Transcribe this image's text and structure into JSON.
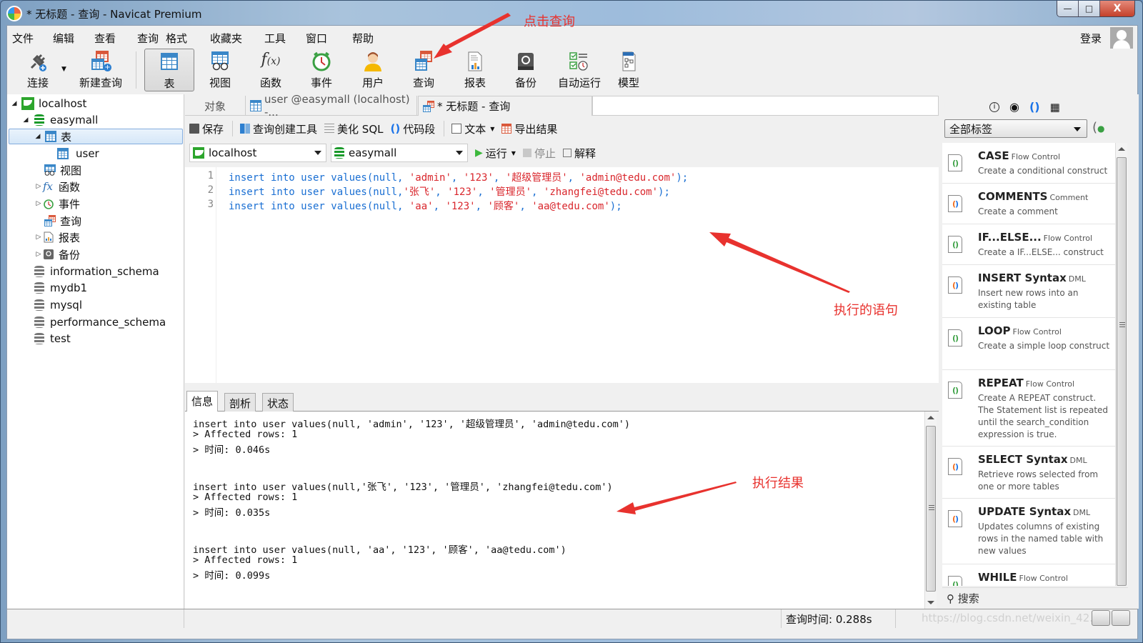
{
  "window": {
    "title": "* 无标题 - 查询 - Navicat Premium",
    "controls": {
      "minimize": "—",
      "maximize": "□",
      "close": "X"
    }
  },
  "menubar": {
    "items": [
      "文件",
      "编辑",
      "查看",
      "查询",
      "格式",
      "收藏夹",
      "工具",
      "窗口",
      "帮助"
    ],
    "login": "登录"
  },
  "toolbar": {
    "items": [
      {
        "label": "连接",
        "icon": "plug-icon"
      },
      {
        "label": "新建查询",
        "icon": "new-query-icon"
      },
      {
        "label": "表",
        "icon": "table-icon",
        "active": true
      },
      {
        "label": "视图",
        "icon": "view-icon"
      },
      {
        "label": "函数",
        "icon": "function-icon"
      },
      {
        "label": "事件",
        "icon": "clock-icon"
      },
      {
        "label": "用户",
        "icon": "user-icon"
      },
      {
        "label": "查询",
        "icon": "query-icon"
      },
      {
        "label": "报表",
        "icon": "report-icon"
      },
      {
        "label": "备份",
        "icon": "backup-icon"
      },
      {
        "label": "自动运行",
        "icon": "schedule-icon"
      },
      {
        "label": "模型",
        "icon": "model-icon"
      }
    ]
  },
  "sidebar": {
    "tree": [
      {
        "label": "localhost",
        "level": 0,
        "expanded": true,
        "type": "server"
      },
      {
        "label": "easymall",
        "level": 1,
        "expanded": true,
        "type": "db-open"
      },
      {
        "label": "表",
        "level": 2,
        "expanded": true,
        "type": "tables",
        "selected": true
      },
      {
        "label": "user",
        "level": 3,
        "type": "table"
      },
      {
        "label": "视图",
        "level": 2,
        "type": "views"
      },
      {
        "label": "函数",
        "level": 2,
        "type": "functions",
        "collapsed": true
      },
      {
        "label": "事件",
        "level": 2,
        "type": "events",
        "collapsed": true
      },
      {
        "label": "查询",
        "level": 2,
        "type": "queries"
      },
      {
        "label": "报表",
        "level": 2,
        "type": "reports",
        "collapsed": true
      },
      {
        "label": "备份",
        "level": 2,
        "type": "backups",
        "collapsed": true
      },
      {
        "label": "information_schema",
        "level": 1,
        "type": "db"
      },
      {
        "label": "mydb1",
        "level": 1,
        "type": "db"
      },
      {
        "label": "mysql",
        "level": 1,
        "type": "db"
      },
      {
        "label": "performance_schema",
        "level": 1,
        "type": "db"
      },
      {
        "label": "test",
        "level": 1,
        "type": "db"
      }
    ]
  },
  "tabs": [
    {
      "label": "对象"
    },
    {
      "label": "user @easymall (localhost) -..."
    },
    {
      "label": "* 无标题 - 查询",
      "active": true
    }
  ],
  "query_toolbar": {
    "save": "保存",
    "builder": "查询创建工具",
    "beautify": "美化 SQL",
    "snippet": "代码段",
    "text": "文本",
    "export": "导出结果"
  },
  "connection_bar": {
    "connection": "localhost",
    "database": "easymall",
    "run": "运行",
    "stop": "停止",
    "explain": "解释"
  },
  "editor": {
    "lines": [
      {
        "no": "1",
        "parts": [
          [
            "k",
            "insert into user values(null, "
          ],
          [
            "s",
            "'admin'"
          ],
          [
            "k",
            ", "
          ],
          [
            "s",
            "'123'"
          ],
          [
            "k",
            ", "
          ],
          [
            "s",
            "'超级管理员'"
          ],
          [
            "k",
            ", "
          ],
          [
            "s",
            "'admin@tedu.com'"
          ],
          [
            "k",
            ");"
          ]
        ]
      },
      {
        "no": "2",
        "parts": [
          [
            "k",
            "insert into user values(null,"
          ],
          [
            "s",
            "'张飞'"
          ],
          [
            "k",
            ", "
          ],
          [
            "s",
            "'123'"
          ],
          [
            "k",
            ", "
          ],
          [
            "s",
            "'管理员'"
          ],
          [
            "k",
            ", "
          ],
          [
            "s",
            "'zhangfei@tedu.com'"
          ],
          [
            "k",
            ");"
          ]
        ]
      },
      {
        "no": "3",
        "parts": [
          [
            "k",
            "insert into user values(null, "
          ],
          [
            "s",
            "'aa'"
          ],
          [
            "k",
            ", "
          ],
          [
            "s",
            "'123'"
          ],
          [
            "k",
            ", "
          ],
          [
            "s",
            "'顾客'"
          ],
          [
            "k",
            ", "
          ],
          [
            "s",
            "'aa@tedu.com'"
          ],
          [
            "k",
            ");"
          ]
        ]
      }
    ]
  },
  "result_tabs": [
    "信息",
    "剖析",
    "状态"
  ],
  "results": {
    "blocks": [
      {
        "sql": "insert into user values(null, 'admin', '123', '超级管理员', 'admin@tedu.com')",
        "affected": "> Affected rows: 1",
        "time": "> 时间: 0.046s"
      },
      {
        "sql": "insert into user values(null,'张飞', '123', '管理员', 'zhangfei@tedu.com')",
        "affected": "> Affected rows: 1",
        "time": "> 时间: 0.035s"
      },
      {
        "sql": "insert into user values(null, 'aa', '123', '顾客', 'aa@tedu.com')",
        "affected": "> Affected rows: 1",
        "time": "> 时间: 0.099s"
      }
    ]
  },
  "right_panel": {
    "tag_filter": "全部标签",
    "search_placeholder": "搜索",
    "snippets": [
      {
        "title": "CASE",
        "category": "Flow Control",
        "desc": "Create a conditional construct",
        "kind": "flow"
      },
      {
        "title": "COMMENTS",
        "category": "Comment",
        "desc": "Create a comment",
        "kind": "dml"
      },
      {
        "title": "IF...ELSE...",
        "category": "Flow Control",
        "desc": "Create a IF...ELSE... construct",
        "kind": "flow"
      },
      {
        "title": "INSERT Syntax",
        "category": "DML",
        "desc": "Insert new rows into an existing table",
        "kind": "dml"
      },
      {
        "title": "LOOP",
        "category": "Flow Control",
        "desc": "Create a simple loop construct",
        "kind": "flow"
      },
      {
        "title": "REPEAT",
        "category": "Flow Control",
        "desc": "Create A REPEAT construct. The Statement list is repeated until the search_condition expression is true.",
        "kind": "flow"
      },
      {
        "title": "SELECT Syntax",
        "category": "DML",
        "desc": "Retrieve rows selected from one or more tables",
        "kind": "dml"
      },
      {
        "title": "UPDATE Syntax",
        "category": "DML",
        "desc": "Updates columns of existing rows in the named table with new values",
        "kind": "dml"
      },
      {
        "title": "WHILE",
        "category": "Flow Control",
        "desc": "",
        "kind": "flow"
      }
    ]
  },
  "statusbar": {
    "query_time": "查询时间: 0.288s",
    "watermark": "https://blog.csdn.net/weixin_42..."
  },
  "annotations": {
    "click_query": "点击查询",
    "executed_statements": "执行的语句",
    "execution_result": "执行结果",
    "color": "#e8322e"
  }
}
